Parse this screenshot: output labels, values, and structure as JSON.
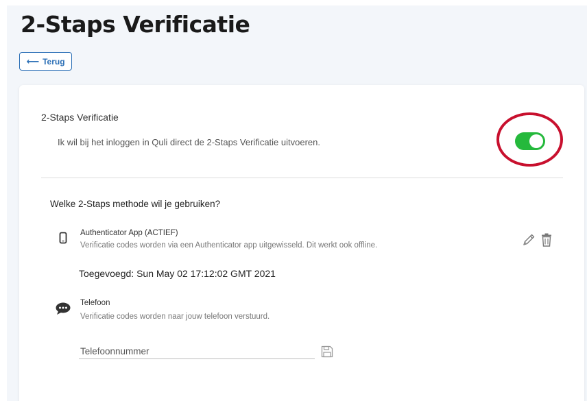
{
  "page": {
    "title": "2-Staps Verificatie",
    "back_label": "Terug"
  },
  "settings": {
    "title": "2-Staps Verificatie",
    "description": "Ik wil bij het inloggen in Quli direct de 2-Staps Verificatie uitvoeren.",
    "enabled": true
  },
  "methods": {
    "question": "Welke 2-Staps methode wil je gebruiken?",
    "authenticator": {
      "name": "Authenticator App (ACTIEF)",
      "description": "Verificatie codes worden via een Authenticator app uitgewisseld. Dit werkt ook offline.",
      "added": "Toegevoegd: Sun May 02 17:12:02 GMT 2021"
    },
    "phone": {
      "name": "Telefoon",
      "description": "Verificatie codes worden naar jouw telefoon verstuurd.",
      "placeholder": "Telefoonnummer"
    }
  },
  "colors": {
    "accent": "#2b6fb6",
    "toggle_on": "#25b93c",
    "highlight": "#c8102e"
  },
  "icons": {
    "back": "arrow-left-icon",
    "authenticator": "smartphone-icon",
    "phone": "chat-bubble-icon",
    "edit": "pencil-icon",
    "delete": "trash-icon",
    "save": "floppy-disk-icon"
  }
}
